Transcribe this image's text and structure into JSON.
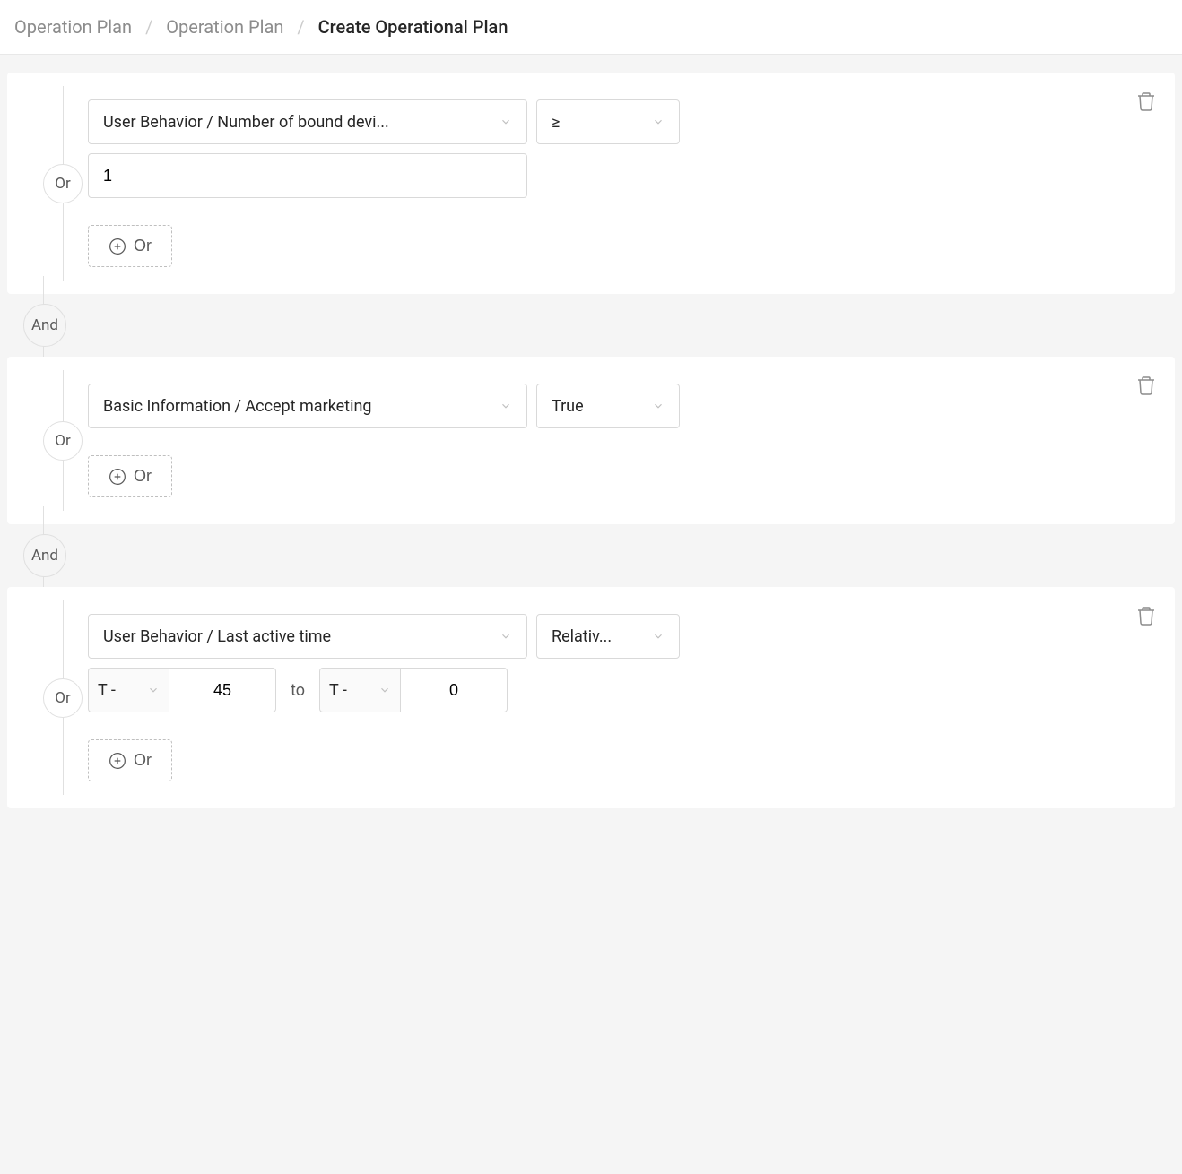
{
  "breadcrumb": {
    "items": [
      "Operation Plan",
      "Operation Plan"
    ],
    "current": "Create Operational Plan"
  },
  "labels": {
    "or": "Or",
    "and": "And",
    "add_or": "Or",
    "to": "to",
    "t_minus": "T -"
  },
  "groups": [
    {
      "rows": [
        {
          "attribute": "User Behavior / Number of bound devi...",
          "operator": "≥",
          "value": "1"
        }
      ]
    },
    {
      "rows": [
        {
          "attribute": "Basic Information / Accept marketing",
          "operator_label": "True"
        }
      ]
    },
    {
      "rows": [
        {
          "attribute": "User Behavior / Last active time",
          "operator_label": "Relativ...",
          "range_from": "45",
          "range_to": "0"
        }
      ]
    }
  ]
}
